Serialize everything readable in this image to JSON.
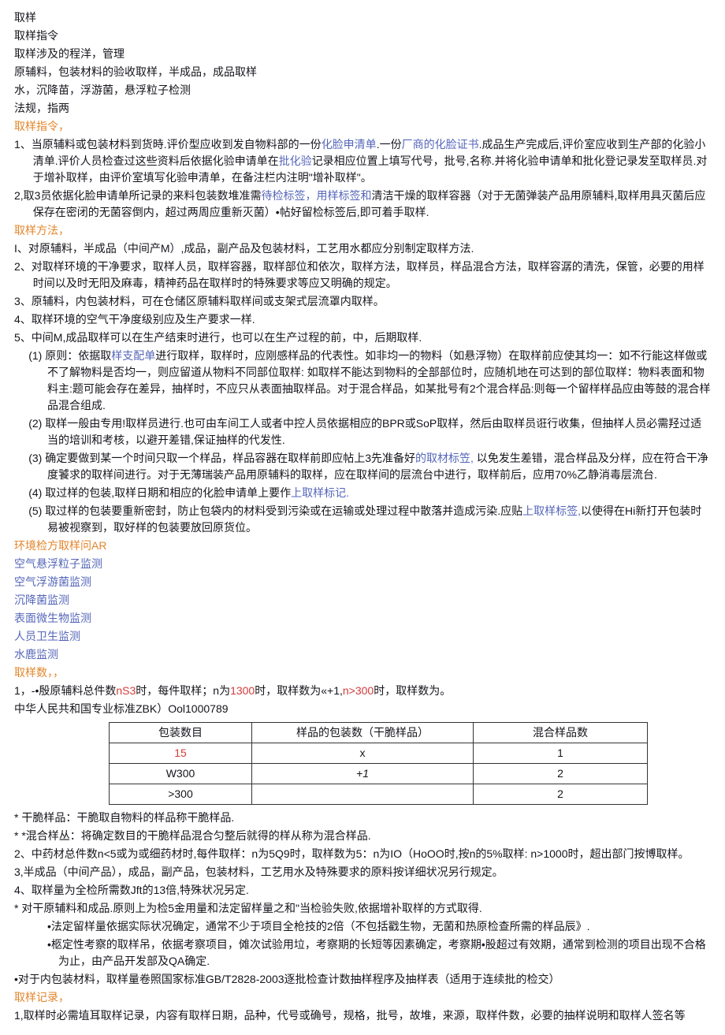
{
  "h1": "取样",
  "h2": "取样指令",
  "h3": "取样涉及的程洋，管理",
  "h4": "原辅料，包装材料的验收取样，半成品，成品取样",
  "h5": "水，沉降苗，浮游菌，悬浮粒子检测",
  "h6": "法规，指两",
  "sec1_title": "取样指令，",
  "s1_p1a": "1、当原辅料或包装材料到货時.评价型应收到发自物料部的一份",
  "s1_p1b": "化脸申清单",
  "s1_p1c": ".一份",
  "s1_p1d": "厂商的化脸证书",
  "s1_p1e": ".成品生产完成后,评价室应收到生产部的化验小清单.评价人员检查过这些资料后依据化验申请单在",
  "s1_p1f": "批化验",
  "s1_p1g": "记录相应位置上填写代号，批号,名称.并将化验申请单和批化登记录发至取样员.对于增补取样，由评价室填写化验申清单，在备注栏内注明\"增补取样\"。",
  "s1_p2a": "2,取3员依据化脸申请单所记录的来料包装数堆准需",
  "s1_p2b": "待检标签，",
  "s1_p2c": "用样标签和",
  "s1_p2d": "清洁干燥的取样容器（对于无菌弹装产品用原辅料,取样用具灭菌后应保存在密闭的无菌容倒内，超过两周应重新灭菌）•帖好留检标签后,即可着手取样.",
  "sec2_title": "取样方法，",
  "s2_p1": "I、对原辅料，半成品（中间产M）,成品，副产品及包装材料，工艺用水都应分别制定取样方法.",
  "s2_p2": "2、对取样环境的干净要求，取样人员，取样容器，取样部位和依次，取样方法，取样员，样品混合方法，取样容潺的清洗，保管，必要的用样时间以及时无阳及麻毒，精神药品在取样时的特殊要求等应又明确的规定。",
  "s2_p3": "3、原辅料，内包装材料，可在仓储区原辅料取样间或支架式层流罩内取样。",
  "s2_p4": "4、取样环境的空气干净度级别应及生产要求一样.",
  "s2_p5": "5、中间M,成品取样可以在生产结束时进行，也可以在生产过程的前，中，后期取样.",
  "s2_p5_1a": "(1) 原则：依据取",
  "s2_p5_1b": "样支配单",
  "s2_p5_1c": "进行取样，取样时，应刚感样品的代表性。如非均一的物料（如悬浮物）在取样前应使其均一：如不行能这样做或不了解物料是否均一，则应留道从物料不同部位取样: 如取样不能达到物料的全部部位时，应随机地在可达到的部位取样：物料表面和物料主:题可能会存在差异，抽样时，不应只从表面抽取样品。对于混合样品，如某批号有2个混合样品:则每一个留样样品应由等鼓的混合样品混合组成.",
  "s2_p5_2": "(2) 取样一般由专用!取样员进行.也可由车间工人或者中控人员依据相应的BPR或SoP取样，然后由取样员诳行收集，但抽样人员必需羟过适当的培训和考核，以避开差错,保证抽样的代发性.",
  "s2_p5_3a": "(3) 确定要做到某一个时间只取一个样品，样品容器在取样前即应帖上3先准备好",
  "s2_p5_3b": "的取材标笠,",
  "s2_p5_3c": " 以免发生差错，混合样品及分样，应在符合干净度饕求的取样间进行。对于无薄瑞装产品用原辅料的取样，应在取样间的层流台中进行，取样前后，应用70%乙静消毒层流台.",
  "s2_p5_4a": "(4) 取过样的包装,取样日期和相应的化脸申请单上要作",
  "s2_p5_4b": "上取样标记.",
  "s2_p5_5a": "(5) 取过样的包装要重新密封，防止包袋内的材料受到污染或在运输或处理过程中散落并造成污染.应贴",
  "s2_p5_5b": "上取样标签,",
  "s2_p5_5c": "以使得在Hi新打开包装时易被视察到，取好样的包装要放回原货位。",
  "env1": "环境检方取样问AR",
  "env2": "空气悬浮粒子监测",
  "env3": "空气浮游菌监测",
  "env4": "沉降菌监测",
  "env5": "表面微生物监测",
  "env6": "人员卫生监测",
  "env7": "水鹿监测",
  "sec3_title": "取样数，，",
  "s3_p1a": "1，-•殷原辅料总件数",
  "s3_p1b": "nS3",
  "s3_p1c": "时，每件取样；n为",
  "s3_p1d": "1300",
  "s3_p1e": "时，取样数为«+1,",
  "s3_p1f": "n>300",
  "s3_p1g": "时，取样数为。",
  "s3_std": "中华人民共和国专业标准ZBK）Ool1000789",
  "th1": "包装数目",
  "th2": "样品的包装数（干脆样品）",
  "th3": "混合样品数",
  "r1c1": "15",
  "r1c2": "x",
  "r1c3": "1",
  "r2c1": "W300",
  "r2c2": "+1",
  "r2c3": "2",
  "r3c1": ">300",
  "r3c2": "",
  "r3c3": "2",
  "note1": "*   干脆样品：干脆取自物料的样品称干脆样品.",
  "note2": "*   *混合样丛：将确定数目的干脆样品混合匀整后就得的样从称为混合样品.",
  "s3_p2": "2、中药材总件数n<5或为或细药材时,每件取样：n为5Q9时，取样数为5：n为IO（HoOO时,按n的5%取样: n>1000时，超出部门按博取样。",
  "s3_p3": "3,半成品（中间产品），成品，副产品，包装材料，工艺用水及特殊要求的原料按详细状况另行规定。",
  "s3_p4": "4、取样量为全检所需数Jft的13倍,特殊状况另定.",
  "note3": "*   对干原辅料和成品.原则上为检5金用量和法定留样量之和\"当检验失败,依据增补取样的方式取得.",
  "note3a": "•法定留样量依据实际状况确定，通常不少于项目全枪技的2倍（不包括戳生物，无菌和热原检查所需的样品辰》.",
  "note3b": "•柩定性考察的取样吊，依据考察项目，傩次试验用垃，考察期的长短等因素确定，考察期•股超过有效期，通常到检测的项目出现不合格为止，由产品开发部及QA确定.",
  "note4": "•对于内包装材料，取样量卷照国家标准GB/T2828-2003逐批检查计数抽样程序及抽样表（适用于连续批的检交）",
  "sec4_title": "取样记录，",
  "s4_p1": "1,取样时必需埴耳取样记录，内容有取样日期，品种，代号或确号，规格，批号，故堆，来源，取样件数，必要的抽样说明和取样人签名等"
}
